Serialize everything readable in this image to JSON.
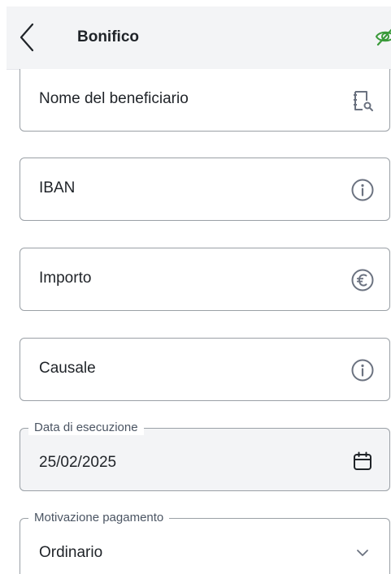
{
  "header": {
    "title": "Bonifico",
    "back_icon": "chevron-left-icon",
    "privacy_icon": "eye-slash-icon",
    "accent_color": "#3a9a3a"
  },
  "form": {
    "beneficiary": {
      "label": "Nome del beneficiario",
      "icon": "address-book-search-icon"
    },
    "iban": {
      "label": "IBAN",
      "icon": "info-icon"
    },
    "amount": {
      "label": "Importo",
      "icon": "euro-icon"
    },
    "reason": {
      "label": "Causale",
      "icon": "info-icon"
    },
    "execution_date": {
      "label": "Data di esecuzione",
      "value": "25/02/2025",
      "icon": "calendar-icon"
    },
    "payment_reason": {
      "label": "Motivazione pagamento",
      "value": "Ordinario",
      "icon": "chevron-down-icon"
    }
  }
}
